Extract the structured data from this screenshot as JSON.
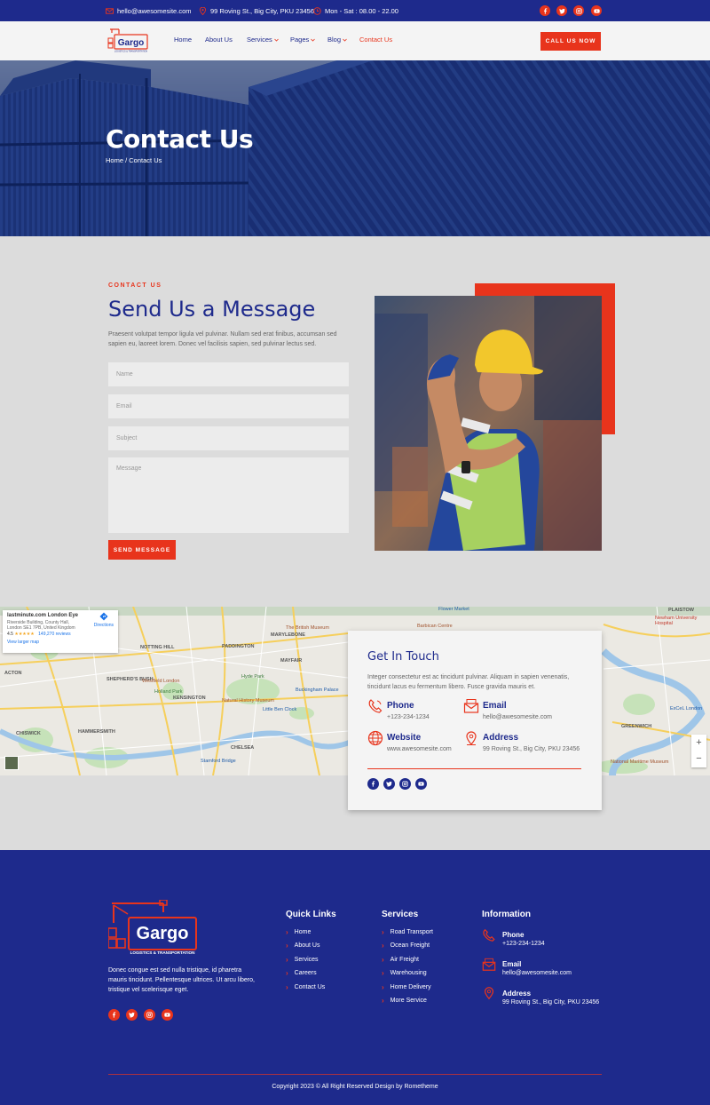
{
  "topbar": {
    "email": "hello@awesomesite.com",
    "address": "99 Roving St., Big City, PKU 23456",
    "hours": "Mon - Sat : 08.00 - 22.00"
  },
  "logo": {
    "name": "Gargo",
    "tagline": "LOGISTICS & TRANSPORTATION"
  },
  "nav": {
    "items": [
      {
        "label": "Home"
      },
      {
        "label": "About Us"
      },
      {
        "label": "Services"
      },
      {
        "label": "Pages"
      },
      {
        "label": "Blog"
      },
      {
        "label": "Contact Us"
      }
    ],
    "cta": "CALL US NOW"
  },
  "hero": {
    "title": "Contact Us",
    "breadcrumb": "Home / Contact Us"
  },
  "contact": {
    "label": "CONTACT US",
    "title": "Send Us a Message",
    "desc": "Praesent volutpat tempor ligula vel pulvinar. Nullam sed erat finibus, accumsan sed sapien eu, laoreet lorem. Donec vel facilisis sapien, sed pulvinar lectus sed.",
    "form": {
      "name_placeholder": "Name",
      "email_placeholder": "Email",
      "subject_placeholder": "Subject",
      "message_placeholder": "Message",
      "submit": "SEND MESSAGE"
    }
  },
  "map": {
    "place": "lastminute.com London Eye",
    "address": "Riverside Building, County Hall, London SE1 7PB, United Kingdom",
    "rating": "4.5",
    "stars": "★★★★★",
    "reviews": "149,270 reviews",
    "directions": "Directions",
    "larger": "View larger map",
    "zoom_in": "+",
    "zoom_out": "−",
    "labels": [
      "NOTTING HILL",
      "MARYLEBONE",
      "PADDINGTON",
      "MAYFAIR",
      "KENSINGTON",
      "SHEPHERD'S BUSH",
      "HAMMERSMITH",
      "CHELSEA",
      "ACTON",
      "CHISWICK",
      "Hyde Park",
      "Holland Park",
      "Westfield London",
      "Natural History Museum",
      "Little Ben Clock",
      "Buckingham Palace",
      "Stamford Bridge",
      "The British Museum",
      "Barbican Centre",
      "Flower Market",
      "PLAISTOW",
      "GREENWICH",
      "ExCeL London",
      "National Maritime Museum",
      "Newham University Hospital"
    ]
  },
  "git": {
    "title": "Get In Touch",
    "desc": "Integer consectetur est ac tincidunt pulvinar. Aliquam in sapien venenatis, tincidunt lacus eu fermentum libero. Fusce gravida mauris et.",
    "phone_label": "Phone",
    "phone": "+123-234-1234",
    "email_label": "Email",
    "email": "hello@awesomesite.com",
    "website_label": "Website",
    "website": "www.awesomesite.com",
    "address_label": "Address",
    "address": "99 Roving St., Big City, PKU 23456"
  },
  "footer": {
    "desc": "Donec congue est sed nulla tristique, id pharetra mauris tincidunt. Pellentesque ultrices. Ut arcu libero, tristique vel scelerisque eget.",
    "quick_title": "Quick Links",
    "quick_links": [
      "Home",
      "About Us",
      "Services",
      "Careers",
      "Contact Us"
    ],
    "services_title": "Services",
    "services": [
      "Road Transport",
      "Ocean Freight",
      "Air Freight",
      "Warehousing",
      "Home Delivery",
      "More Service"
    ],
    "info_title": "Information",
    "phone_label": "Phone",
    "phone": "+123-234-1234",
    "email_label": "Email",
    "email": "hello@awesomesite.com",
    "address_label": "Address",
    "address": "99 Roving St., Big City, PKU 23456",
    "copyright": "Copyright 2023 © All Right Reserved Design by Rometheme"
  },
  "colors": {
    "primary": "#1e2a8c",
    "accent": "#e8341c"
  }
}
